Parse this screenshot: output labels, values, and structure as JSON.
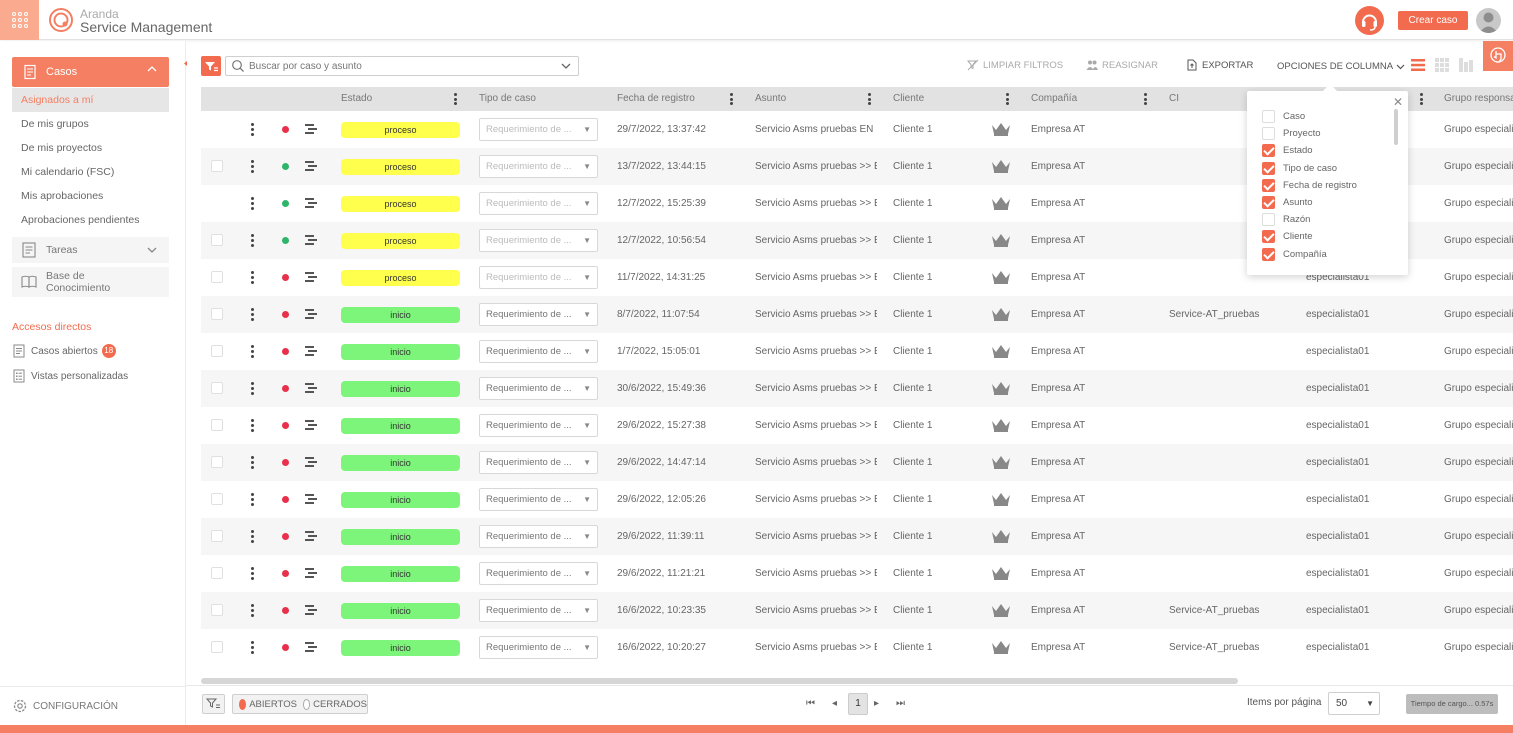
{
  "header": {
    "brand_line1": "Aranda",
    "brand_line2": "Service Management",
    "create_label": "Crear caso"
  },
  "sidebar": {
    "cases_label": "Casos",
    "subitems": [
      "Asignados a mí",
      "De mis grupos",
      "De mis proyectos",
      "Mi calendario (FSC)",
      "Mis aprobaciones",
      "Aprobaciones pendientes"
    ],
    "tasks_label": "Tareas",
    "kb_label": "Base de Conocimiento",
    "direct_title": "Accesos directos",
    "open_cases_label": "Casos abiertos",
    "open_cases_count": "18",
    "custom_views_label": "Vistas personalizadas",
    "config_label": "CONFIGURACIÓN"
  },
  "toolbar": {
    "search_placeholder": "Buscar por caso y asunto",
    "clear_filters": "LIMPIAR FILTROS",
    "reassign": "REASIGNAR",
    "export": "EXPORTAR",
    "column_options": "OPCIONES DE COLUMNA"
  },
  "columns": [
    "Estado",
    "Tipo de caso",
    "Fecha de registro",
    "Asunto",
    "Cliente",
    "Compañía",
    "CI",
    "Grupo responsa"
  ],
  "rows": [
    {
      "status": "proceso",
      "dot": "red",
      "type": "Requerimiento de ...",
      "type_disabled": true,
      "date": "29/7/2022, 13:37:42",
      "subject": "Servicio Asms pruebas EN ...",
      "client": "Cliente 1",
      "company": "Empresa AT",
      "ci": "",
      "specialist": "",
      "group": "Grupo especiali",
      "checkbox": false
    },
    {
      "status": "proceso",
      "dot": "green",
      "type": "Requerimiento de ...",
      "type_disabled": true,
      "date": "13/7/2022, 13:44:15",
      "subject": "Servicio Asms pruebas >> E...",
      "client": "Cliente 1",
      "company": "Empresa AT",
      "ci": "",
      "specialist": "",
      "group": "Grupo especiali",
      "checkbox": true
    },
    {
      "status": "proceso",
      "dot": "green",
      "type": "Requerimiento de ...",
      "type_disabled": true,
      "date": "12/7/2022, 15:25:39",
      "subject": "Servicio Asms pruebas >> E...",
      "client": "Cliente 1",
      "company": "Empresa AT",
      "ci": "",
      "specialist": "",
      "group": "Grupo especiali",
      "checkbox": false
    },
    {
      "status": "proceso",
      "dot": "green",
      "type": "Requerimiento de ...",
      "type_disabled": true,
      "date": "12/7/2022, 10:56:54",
      "subject": "Servicio Asms pruebas >> E...",
      "client": "Cliente 1",
      "company": "Empresa AT",
      "ci": "",
      "specialist": "",
      "group": "Grupo especiali",
      "checkbox": true
    },
    {
      "status": "proceso",
      "dot": "red",
      "type": "Requerimiento de ...",
      "type_disabled": true,
      "date": "11/7/2022, 14:31:25",
      "subject": "Servicio Asms pruebas >> E...",
      "client": "Cliente 1",
      "company": "Empresa AT",
      "ci": "",
      "specialist": "especialista01",
      "group": "Grupo especiali",
      "checkbox": true
    },
    {
      "status": "inicio",
      "dot": "red",
      "type": "Requerimiento de ...",
      "type_disabled": false,
      "date": "8/7/2022, 11:07:54",
      "subject": "Servicio Asms pruebas >> E...",
      "client": "Cliente 1",
      "company": "Empresa AT",
      "ci": "Service-AT_pruebas",
      "specialist": "especialista01",
      "group": "Grupo especiali",
      "checkbox": true
    },
    {
      "status": "inicio",
      "dot": "red",
      "type": "Requerimiento de ...",
      "type_disabled": false,
      "date": "1/7/2022, 15:05:01",
      "subject": "Servicio Asms pruebas >> E...",
      "client": "Cliente 1",
      "company": "Empresa AT",
      "ci": "",
      "specialist": "especialista01",
      "group": "Grupo especiali",
      "checkbox": true
    },
    {
      "status": "inicio",
      "dot": "red",
      "type": "Requerimiento de ...",
      "type_disabled": false,
      "date": "30/6/2022, 15:49:36",
      "subject": "Servicio Asms pruebas >> E...",
      "client": "Cliente 1",
      "company": "Empresa AT",
      "ci": "",
      "specialist": "especialista01",
      "group": "Grupo especiali",
      "checkbox": true
    },
    {
      "status": "inicio",
      "dot": "red",
      "type": "Requerimiento de ...",
      "type_disabled": false,
      "date": "29/6/2022, 15:27:38",
      "subject": "Servicio Asms pruebas >> E...",
      "client": "Cliente 1",
      "company": "Empresa AT",
      "ci": "",
      "specialist": "especialista01",
      "group": "Grupo especiali",
      "checkbox": true
    },
    {
      "status": "inicio",
      "dot": "red",
      "type": "Requerimiento de ...",
      "type_disabled": false,
      "date": "29/6/2022, 14:47:14",
      "subject": "Servicio Asms pruebas >> E...",
      "client": "Cliente 1",
      "company": "Empresa AT",
      "ci": "",
      "specialist": "especialista01",
      "group": "Grupo especiali",
      "checkbox": true
    },
    {
      "status": "inicio",
      "dot": "red",
      "type": "Requerimiento de ...",
      "type_disabled": false,
      "date": "29/6/2022, 12:05:26",
      "subject": "Servicio Asms pruebas >> E...",
      "client": "Cliente 1",
      "company": "Empresa AT",
      "ci": "",
      "specialist": "especialista01",
      "group": "Grupo especiali",
      "checkbox": true
    },
    {
      "status": "inicio",
      "dot": "red",
      "type": "Requerimiento de ...",
      "type_disabled": false,
      "date": "29/6/2022, 11:39:11",
      "subject": "Servicio Asms pruebas >> E...",
      "client": "Cliente 1",
      "company": "Empresa AT",
      "ci": "",
      "specialist": "especialista01",
      "group": "Grupo especiali",
      "checkbox": true
    },
    {
      "status": "inicio",
      "dot": "red",
      "type": "Requerimiento de ...",
      "type_disabled": false,
      "date": "29/6/2022, 11:21:21",
      "subject": "Servicio Asms pruebas >> E...",
      "client": "Cliente 1",
      "company": "Empresa AT",
      "ci": "",
      "specialist": "especialista01",
      "group": "Grupo especiali",
      "checkbox": true
    },
    {
      "status": "inicio",
      "dot": "red",
      "type": "Requerimiento de ...",
      "type_disabled": false,
      "date": "16/6/2022, 10:23:35",
      "subject": "Servicio Asms pruebas >> E...",
      "client": "Cliente 1",
      "company": "Empresa AT",
      "ci": "Service-AT_pruebas",
      "specialist": "especialista01",
      "group": "Grupo especiali",
      "checkbox": true
    },
    {
      "status": "inicio",
      "dot": "red",
      "type": "Requerimiento de ...",
      "type_disabled": false,
      "date": "16/6/2022, 10:20:27",
      "subject": "Servicio Asms pruebas >> E...",
      "client": "Cliente 1",
      "company": "Empresa AT",
      "ci": "Service-AT_pruebas",
      "specialist": "especialista01",
      "group": "Grupo especiali",
      "checkbox": true
    }
  ],
  "column_panel": {
    "items": [
      {
        "label": "Caso",
        "checked": false
      },
      {
        "label": "Proyecto",
        "checked": false
      },
      {
        "label": "Estado",
        "checked": true
      },
      {
        "label": "Tipo de caso",
        "checked": true
      },
      {
        "label": "Fecha de registro",
        "checked": true
      },
      {
        "label": "Asunto",
        "checked": true
      },
      {
        "label": "Razón",
        "checked": false
      },
      {
        "label": "Cliente",
        "checked": true
      },
      {
        "label": "Compañía",
        "checked": true
      }
    ]
  },
  "footer": {
    "open_label": "ABIERTOS",
    "closed_label": "CERRADOS",
    "current_page": "1",
    "items_per_page_label": "Items por página",
    "items_per_page": "50",
    "load_time": "Tiempo de cargo... 0.57s"
  },
  "colors": {
    "accent": "#f26b4f",
    "status_proceso": "#ffff4d",
    "status_inicio": "#7df57a",
    "dot_red": "#e8304a",
    "dot_green": "#2fb56a"
  },
  "icons": {
    "app_grid": "apps-grid-icon",
    "logo": "aranda-logo-icon",
    "support": "headset-icon",
    "user": "user-avatar-icon",
    "cases": "document-icon",
    "tasks": "tasks-icon",
    "kb": "book-icon",
    "filter": "filter-icon",
    "search": "search-icon",
    "export": "export-icon",
    "reassign": "users-icon",
    "config": "gear-icon",
    "crown": "crown-icon"
  }
}
